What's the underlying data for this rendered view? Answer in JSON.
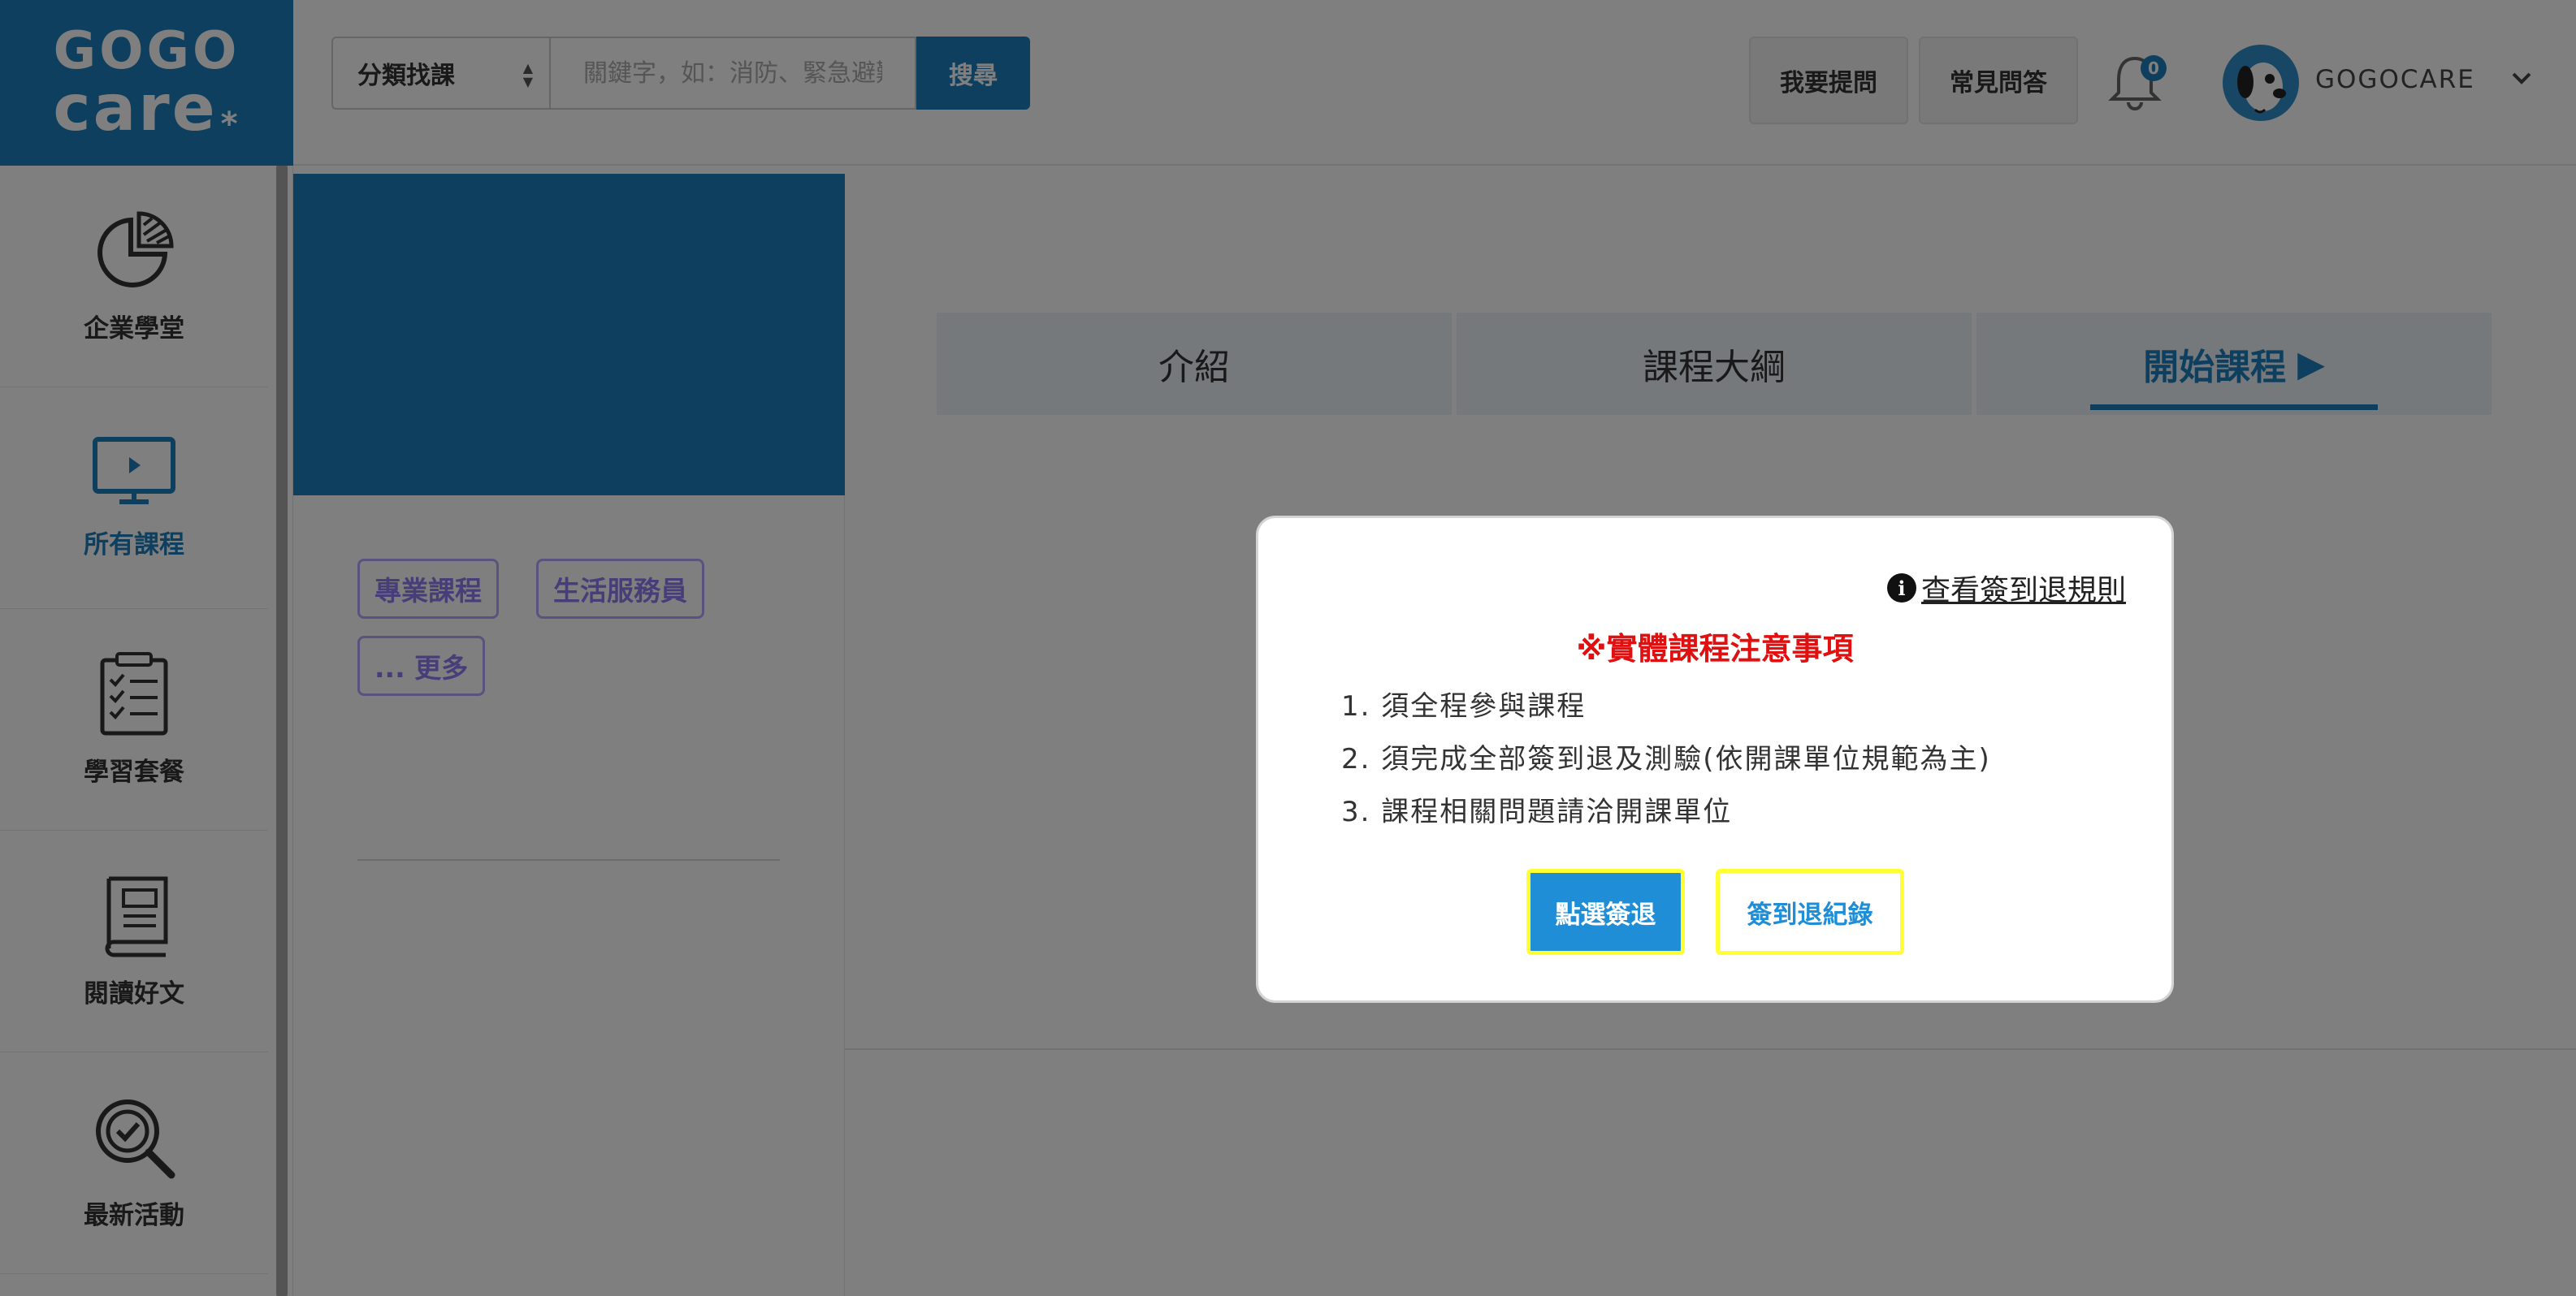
{
  "brand": {
    "line1": "GOGO",
    "line2": "care",
    "mark": "*",
    "color": "#1f7fbd"
  },
  "sidebar": {
    "items": [
      {
        "label": "企業學堂",
        "icon": "pie-chart-icon",
        "active": false
      },
      {
        "label": "所有課程",
        "icon": "monitor-play-icon",
        "active": true
      },
      {
        "label": "學習套餐",
        "icon": "checklist-icon",
        "active": false
      },
      {
        "label": "閱讀好文",
        "icon": "book-icon",
        "active": false
      },
      {
        "label": "最新活動",
        "icon": "search-check-icon",
        "active": false
      }
    ]
  },
  "header": {
    "category_label": "分類找課",
    "search_placeholder": "關鍵字，如：消防、緊急避難",
    "search_button": "搜尋",
    "ask_button": "我要提問",
    "faq_button": "常見問答",
    "notification_count": "0",
    "user_name": "GOGOCARE"
  },
  "course": {
    "tags": [
      "專業課程",
      "生活服務員",
      "... 更多"
    ],
    "tabs": [
      {
        "label": "介紹",
        "active": false
      },
      {
        "label": "課程大綱",
        "active": false
      },
      {
        "label": "開始課程",
        "active": true,
        "icon": "play-icon"
      }
    ]
  },
  "modal": {
    "rules_link": "查看簽到退規則",
    "notice_title": "※實體課程注意事項",
    "notices": [
      "1. 須全程參與課程",
      "2. 須完成全部簽到退及測驗(依開課單位規範為主)",
      "3. 課程相關問題請洽開課單位"
    ],
    "checkin_button": "點選簽退",
    "record_button": "簽到退紀錄"
  },
  "colors": {
    "accent": "#1f7fbd",
    "warning": "#e01010",
    "tag": "#8e7cf3",
    "button_highlight": "#ffff33"
  }
}
